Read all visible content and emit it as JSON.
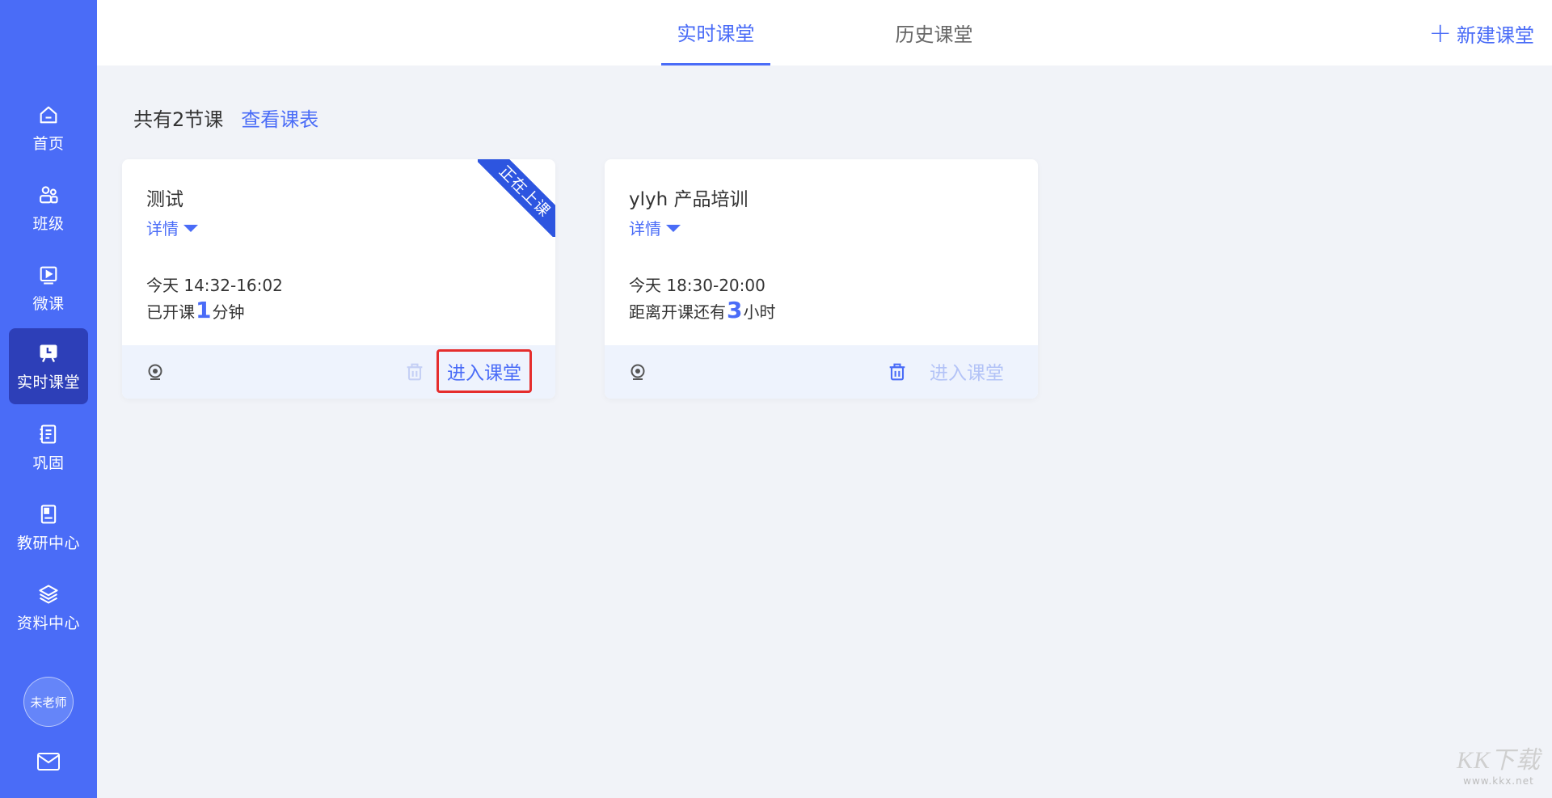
{
  "sidebar": {
    "items": [
      {
        "label": "首页",
        "icon": "home-icon"
      },
      {
        "label": "班级",
        "icon": "class-users-icon"
      },
      {
        "label": "微课",
        "icon": "micro-lesson-icon"
      },
      {
        "label": "实时课堂",
        "icon": "live-classroom-icon",
        "active": true
      },
      {
        "label": "巩固",
        "icon": "notebook-icon"
      },
      {
        "label": "教研中心",
        "icon": "research-book-icon"
      },
      {
        "label": "资料中心",
        "icon": "layers-icon"
      }
    ],
    "avatar_label": "未老师",
    "mail_icon": "mail-icon"
  },
  "header": {
    "tabs": [
      {
        "label": "实时课堂",
        "active": true
      },
      {
        "label": "历史课堂",
        "active": false
      }
    ],
    "new_class_label": "新建课堂"
  },
  "summary": {
    "count_text": "共有2节课",
    "schedule_link": "查看课表"
  },
  "cards": [
    {
      "title": "测试",
      "detail_label": "详情",
      "time": "今天 14:32-16:02",
      "status_prefix": "已开课",
      "status_number": "1",
      "status_suffix": "分钟",
      "ribbon": "正在上课",
      "enter_label": "进入课堂",
      "enter_enabled": true
    },
    {
      "title": "ylyh 产品培训",
      "detail_label": "详情",
      "time": "今天 18:30-20:00",
      "status_prefix": "距离开课还有",
      "status_number": "3",
      "status_suffix": "小时",
      "enter_label": "进入课堂",
      "enter_enabled": false
    }
  ],
  "watermark": {
    "logo": "KK下载",
    "url": "www.kkx.net"
  },
  "colors": {
    "accent": "#4a6cf7",
    "sidebar_active": "#2d3fb8",
    "highlight_border": "#e52d2d",
    "background": "#f1f3f8"
  }
}
